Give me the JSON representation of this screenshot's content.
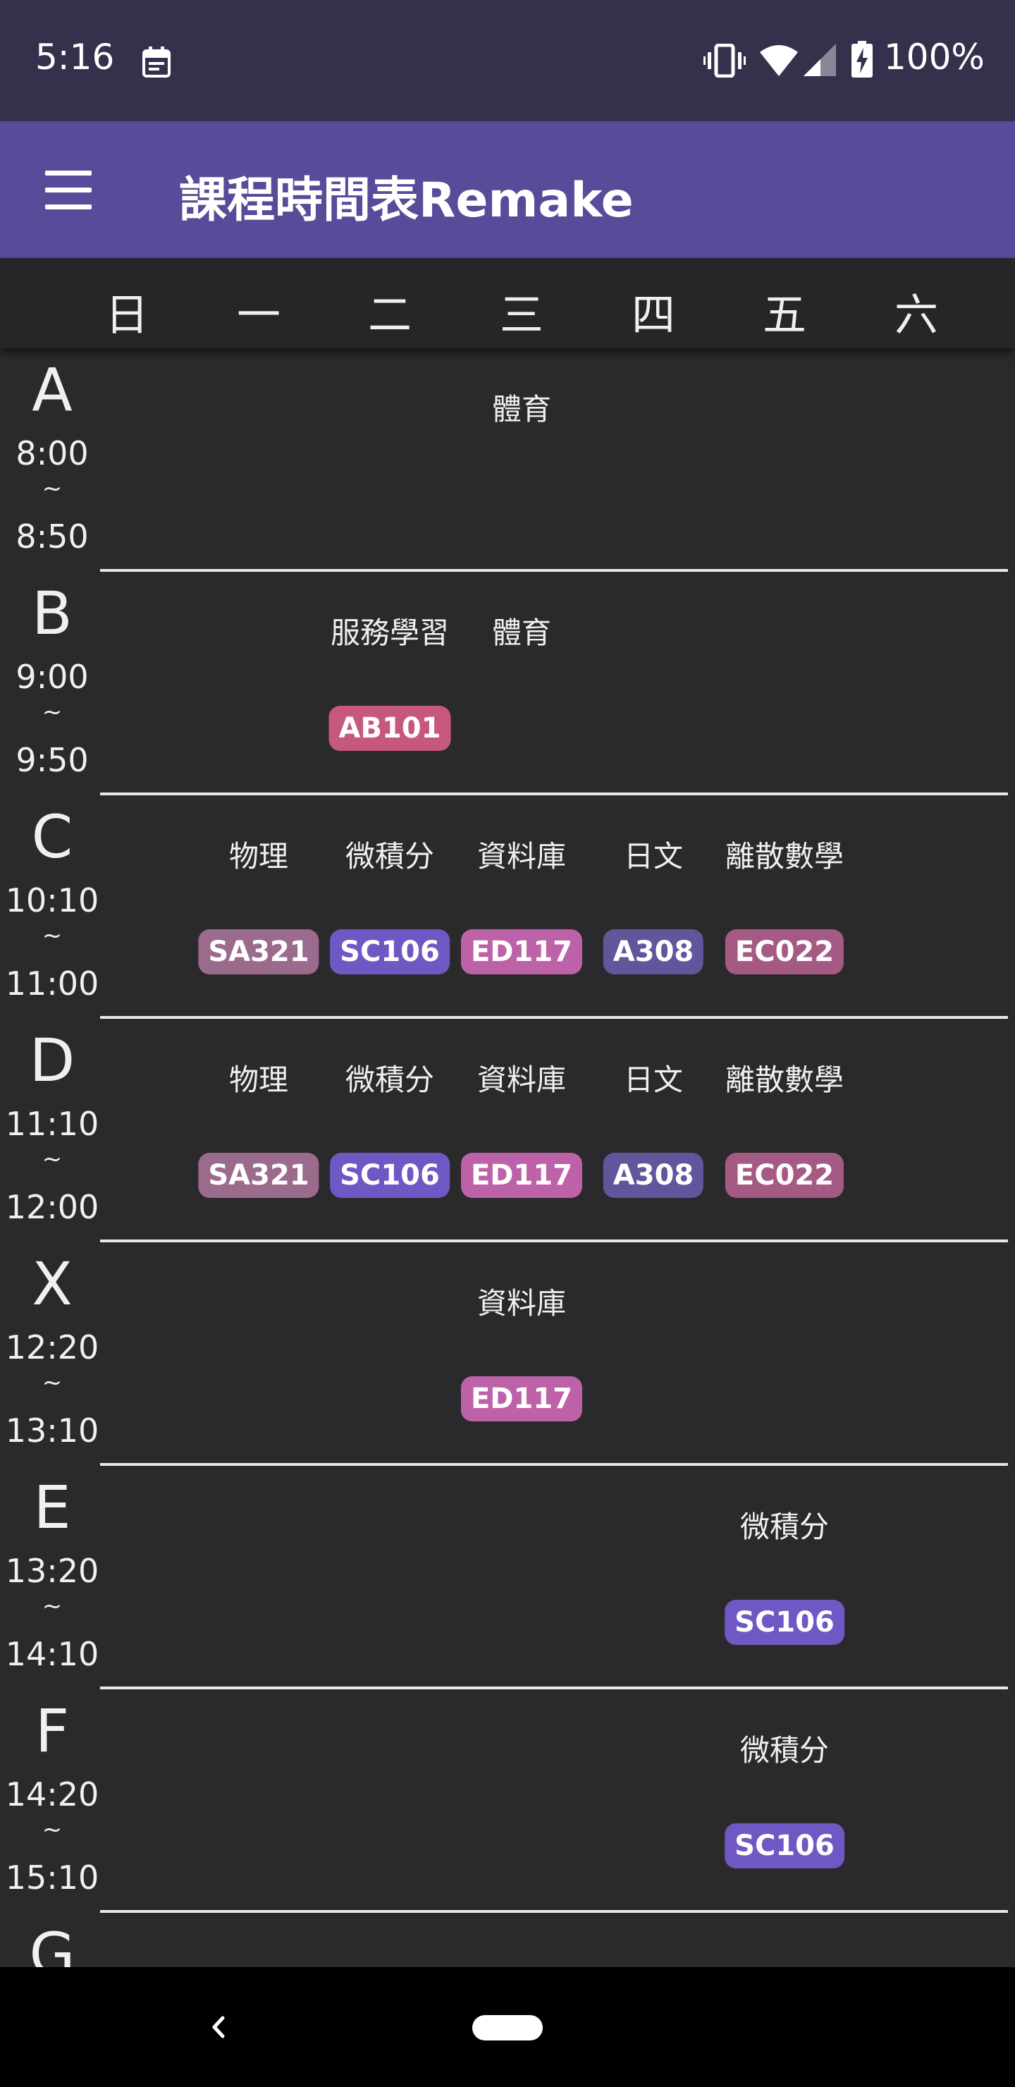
{
  "status_bar": {
    "time": "5:16",
    "battery_text": "100%",
    "icons": [
      "calendar-icon",
      "vibrate-icon",
      "wifi-icon",
      "signal-icon",
      "battery-charging-icon"
    ]
  },
  "app_bar": {
    "title": "課程時間表Remake",
    "menu_icon": "menu-icon"
  },
  "days": [
    "日",
    "一",
    "二",
    "三",
    "四",
    "五",
    "六"
  ],
  "periods": [
    {
      "letter": "A",
      "start": "8:00",
      "tilde": "~",
      "end": "8:50"
    },
    {
      "letter": "B",
      "start": "9:00",
      "tilde": "~",
      "end": "9:50"
    },
    {
      "letter": "C",
      "start": "10:10",
      "tilde": "~",
      "end": "11:00"
    },
    {
      "letter": "D",
      "start": "11:10",
      "tilde": "~",
      "end": "12:00"
    },
    {
      "letter": "X",
      "start": "12:20",
      "tilde": "~",
      "end": "13:10"
    },
    {
      "letter": "E",
      "start": "13:20",
      "tilde": "~",
      "end": "14:10"
    },
    {
      "letter": "F",
      "start": "14:20",
      "tilde": "~",
      "end": "15:10"
    },
    {
      "letter": "G",
      "start": "",
      "tilde": "",
      "end": ""
    }
  ],
  "courses": [
    {
      "period": 0,
      "day": 3,
      "name": "體育",
      "room": "",
      "color": ""
    },
    {
      "period": 1,
      "day": 2,
      "name": "服務學習",
      "room": "AB101",
      "color": "#c7587d"
    },
    {
      "period": 1,
      "day": 3,
      "name": "體育",
      "room": "",
      "color": ""
    },
    {
      "period": 2,
      "day": 1,
      "name": "物理",
      "room": "SA321",
      "color": "#9a6b8c"
    },
    {
      "period": 2,
      "day": 2,
      "name": "微積分",
      "room": "SC106",
      "color": "#6f58c4"
    },
    {
      "period": 2,
      "day": 3,
      "name": "資料庫",
      "room": "ED117",
      "color": "#bd62a8"
    },
    {
      "period": 2,
      "day": 4,
      "name": "日文",
      "room": "A308",
      "color": "#62559b"
    },
    {
      "period": 2,
      "day": 5,
      "name": "離散數學",
      "room": "EC022",
      "color": "#a55a84"
    },
    {
      "period": 3,
      "day": 1,
      "name": "物理",
      "room": "SA321",
      "color": "#9a6b8c"
    },
    {
      "period": 3,
      "day": 2,
      "name": "微積分",
      "room": "SC106",
      "color": "#6f58c4"
    },
    {
      "period": 3,
      "day": 3,
      "name": "資料庫",
      "room": "ED117",
      "color": "#bd62a8"
    },
    {
      "period": 3,
      "day": 4,
      "name": "日文",
      "room": "A308",
      "color": "#62559b"
    },
    {
      "period": 3,
      "day": 5,
      "name": "離散數學",
      "room": "EC022",
      "color": "#a55a84"
    },
    {
      "period": 4,
      "day": 3,
      "name": "資料庫",
      "room": "ED117",
      "color": "#bd62a8"
    },
    {
      "period": 5,
      "day": 5,
      "name": "微積分",
      "room": "SC106",
      "color": "#6f58c4"
    },
    {
      "period": 6,
      "day": 5,
      "name": "微積分",
      "room": "SC106",
      "color": "#6f58c4"
    }
  ],
  "nav_bar": {
    "icons": [
      "back-icon",
      "home-pill-icon"
    ]
  },
  "colors": {
    "status_bar": "#37304d",
    "app_bar": "#584b99",
    "background": "#2a2a2c",
    "header": "#262628"
  }
}
